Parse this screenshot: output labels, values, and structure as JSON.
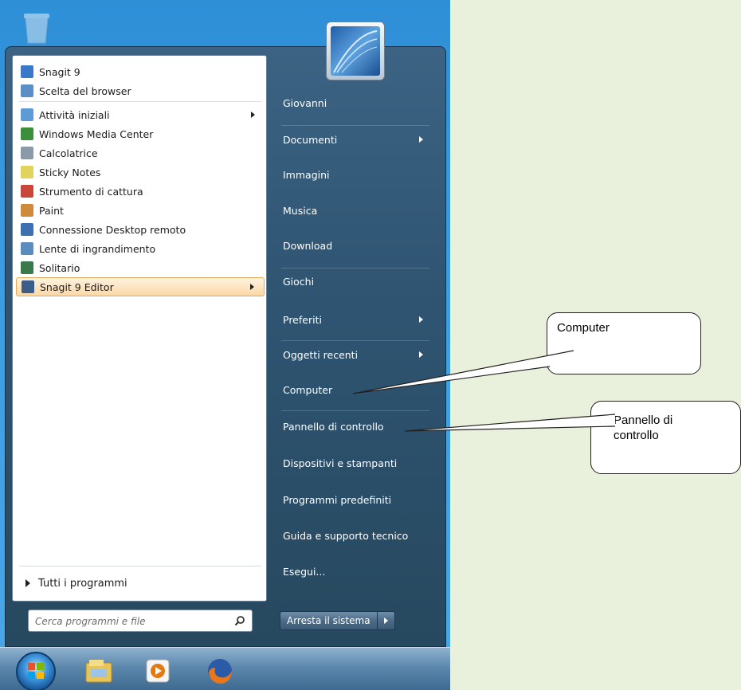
{
  "start_menu": {
    "programs": [
      {
        "label": "Snagit 9",
        "icon": "snagit-icon",
        "color": "#3a78c8",
        "submenu": false,
        "highlighted": false
      },
      {
        "label": "Scelta del browser",
        "icon": "browser-choice-icon",
        "color": "#5b90c6",
        "submenu": false,
        "highlighted": false
      },
      {
        "label": "Attività iniziali",
        "icon": "getting-started-icon",
        "color": "#5e9ad6",
        "submenu": true,
        "highlighted": false
      },
      {
        "label": "Windows Media Center",
        "icon": "media-center-icon",
        "color": "#3b8e3a",
        "submenu": false,
        "highlighted": false
      },
      {
        "label": "Calcolatrice",
        "icon": "calculator-icon",
        "color": "#8a9aaa",
        "submenu": false,
        "highlighted": false
      },
      {
        "label": "Sticky Notes",
        "icon": "sticky-notes-icon",
        "color": "#e2d35c",
        "submenu": false,
        "highlighted": false
      },
      {
        "label": "Strumento di cattura",
        "icon": "snipping-tool-icon",
        "color": "#c9463a",
        "submenu": false,
        "highlighted": false
      },
      {
        "label": "Paint",
        "icon": "paint-icon",
        "color": "#d08b3a",
        "submenu": false,
        "highlighted": false
      },
      {
        "label": "Connessione Desktop remoto",
        "icon": "remote-desktop-icon",
        "color": "#3d70b0",
        "submenu": false,
        "highlighted": false
      },
      {
        "label": "Lente di ingrandimento",
        "icon": "magnifier-icon",
        "color": "#5a8cc0",
        "submenu": false,
        "highlighted": false
      },
      {
        "label": "Solitario",
        "icon": "solitaire-icon",
        "color": "#3a7a4a",
        "submenu": false,
        "highlighted": false
      },
      {
        "label": "Snagit 9 Editor",
        "icon": "snagit-editor-icon",
        "color": "#3a5d8a",
        "submenu": true,
        "highlighted": true
      }
    ],
    "all_programs": "Tutti i programmi",
    "search_placeholder": "Cerca programmi e file",
    "right_items": [
      {
        "label": "Giovanni",
        "submenu": false
      },
      {
        "label": "Documenti",
        "submenu": true
      },
      {
        "label": "Immagini",
        "submenu": false
      },
      {
        "label": "Musica",
        "submenu": false
      },
      {
        "label": "Download",
        "submenu": false
      },
      {
        "label": "Giochi",
        "submenu": false
      },
      {
        "label": "Preferiti",
        "submenu": true
      },
      {
        "label": "Oggetti recenti",
        "submenu": true
      },
      {
        "label": "Computer",
        "submenu": false
      },
      {
        "label": "Pannello di controllo",
        "submenu": false
      },
      {
        "label": "Dispositivi e stampanti",
        "submenu": false
      },
      {
        "label": "Programmi predefiniti",
        "submenu": false
      },
      {
        "label": "Guida e supporto tecnico",
        "submenu": false
      },
      {
        "label": "Esegui...",
        "submenu": false
      }
    ],
    "shutdown_label": "Arresta il sistema"
  },
  "taskbar": {
    "apps": [
      {
        "icon": "windows-explorer-icon"
      },
      {
        "icon": "media-player-icon"
      },
      {
        "icon": "firefox-icon"
      }
    ]
  },
  "callouts": [
    {
      "text": "Computer"
    },
    {
      "text": "Pannello di controllo"
    }
  ]
}
